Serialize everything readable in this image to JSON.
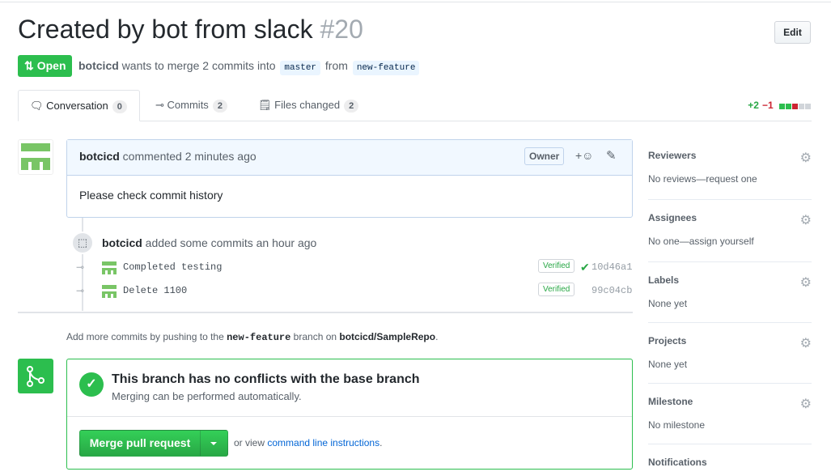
{
  "pr": {
    "title": "Created by bot from slack",
    "number": "#20",
    "edit_label": "Edit",
    "state": "Open",
    "author": "botcicd",
    "merge_text": "wants to merge 2 commits into",
    "base_branch": "master",
    "from_text": "from",
    "head_branch": "new-feature"
  },
  "tabs": [
    {
      "label": "Conversation",
      "count": "0"
    },
    {
      "label": "Commits",
      "count": "2"
    },
    {
      "label": "Files changed",
      "count": "2"
    }
  ],
  "diffstat": {
    "additions": "+2",
    "deletions": "−1"
  },
  "comment": {
    "author": "botcicd",
    "action": "commented 2 minutes ago",
    "role": "Owner",
    "body": "Please check commit history"
  },
  "event": {
    "author": "botcicd",
    "action": "added some commits an hour ago"
  },
  "commits": [
    {
      "message": "Completed testing",
      "badge": "Verified",
      "sha": "10d46a1"
    },
    {
      "message": "Delete 1100",
      "badge": "Verified",
      "sha": "99c04cb"
    }
  ],
  "hint": {
    "prefix": "Add more commits by pushing to the",
    "branch": "new-feature",
    "middle": "branch on",
    "repo": "botcicd/SampleRepo",
    "suffix": "."
  },
  "merge": {
    "title": "This branch has no conflicts with the base branch",
    "subtitle": "Merging can be performed automatically.",
    "button": "Merge pull request",
    "or_text": "or view",
    "link": "command line instructions",
    "end": "."
  },
  "sidebar": [
    {
      "title": "Reviewers",
      "value": "No reviews—request one"
    },
    {
      "title": "Assignees",
      "value": "No one—assign yourself"
    },
    {
      "title": "Labels",
      "value": "None yet"
    },
    {
      "title": "Projects",
      "value": "None yet"
    },
    {
      "title": "Milestone",
      "value": "No milestone"
    },
    {
      "title": "Notifications",
      "value": ""
    }
  ],
  "colors": {
    "green": "#2cbe4e",
    "link": "#0366d6",
    "danger": "#cb2431"
  }
}
